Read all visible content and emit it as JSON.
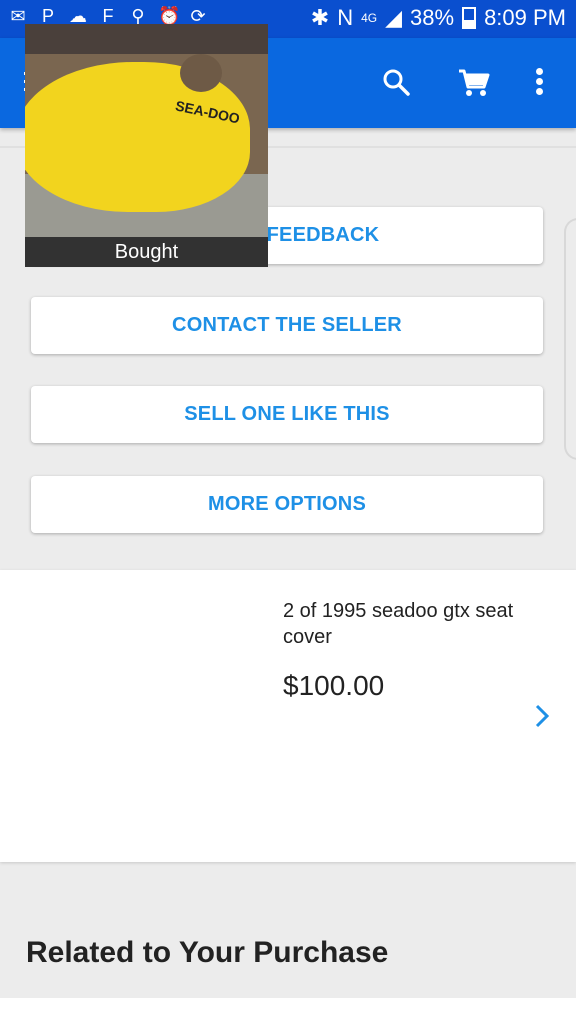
{
  "status_bar": {
    "icons": [
      "gmail-icon",
      "paypal-icon",
      "cloud-icon",
      "flipboard-icon",
      "usb-icon",
      "alarm-icon",
      "sync-icon",
      "bluetooth-icon",
      "nfc-icon",
      "4g-icon",
      "signal-icon"
    ],
    "network": "4G",
    "battery": "38%",
    "time": "8:09 PM"
  },
  "app_bar": {
    "logo": "ebay",
    "brand_color": "#0a68e0",
    "status_color": "#0a4fcf"
  },
  "actions": [
    {
      "label": "LEAVE FEEDBACK"
    },
    {
      "label": "CONTACT THE SELLER"
    },
    {
      "label": "SELL ONE LIKE THIS"
    },
    {
      "label": "MORE OPTIONS"
    }
  ],
  "item": {
    "title": "2 of 1995 seadoo gtx seat cover",
    "price": "$100.00",
    "image_label": "Bought",
    "image_brand_text": "SEA-DOO"
  },
  "section": {
    "related_title": "Related to Your Purchase"
  },
  "accent_color": "#1e90e6"
}
